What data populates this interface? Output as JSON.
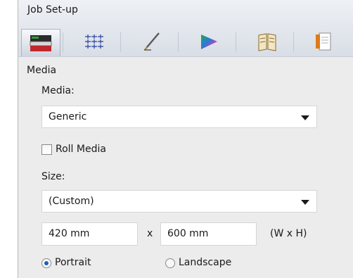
{
  "header": {
    "title": "Job Set-up"
  },
  "toolbar": {
    "buttons": [
      {
        "icon": "media-printer-icon",
        "active": true
      },
      {
        "icon": "grid-layout-icon",
        "active": false
      },
      {
        "icon": "pen-calibration-icon",
        "active": false
      },
      {
        "icon": "color-triangle-icon",
        "active": false
      },
      {
        "icon": "book-finishing-icon",
        "active": false
      },
      {
        "icon": "document-properties-icon",
        "active": false
      }
    ]
  },
  "media_section": {
    "title": "Media",
    "media_label": "Media:",
    "media_value": "Generic",
    "roll_media_label": "Roll Media",
    "roll_media_checked": false,
    "size_label": "Size:",
    "size_value": "(Custom)",
    "width_value": "420 mm",
    "times_label": "x",
    "height_value": "600 mm",
    "dims_hint": "(W x H)",
    "orientation": {
      "portrait_label": "Portrait",
      "landscape_label": "Landscape",
      "selected": "Portrait"
    }
  }
}
